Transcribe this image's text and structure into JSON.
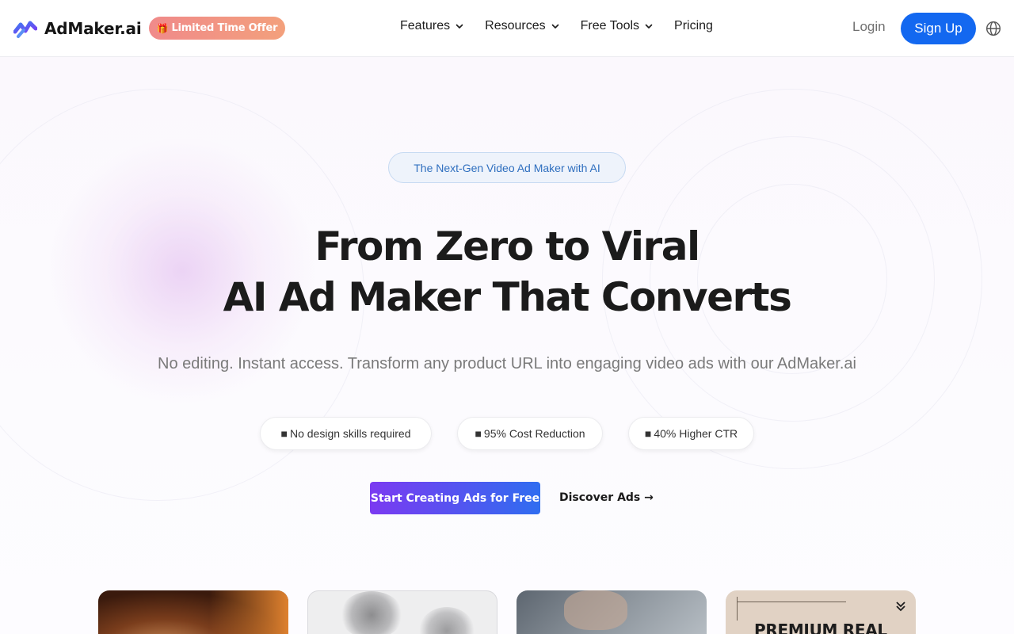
{
  "brand": {
    "name": "AdMaker.ai",
    "offer_label": "Limited Time Offer",
    "offer_icon": "gift-icon"
  },
  "nav": {
    "items": [
      {
        "label": "Features",
        "has_dropdown": true
      },
      {
        "label": "Resources",
        "has_dropdown": true
      },
      {
        "label": "Free Tools",
        "has_dropdown": true
      },
      {
        "label": "Pricing",
        "has_dropdown": false
      }
    ],
    "login_label": "Login",
    "signup_label": "Sign Up",
    "language_icon": "globe-icon"
  },
  "hero": {
    "tag": "The Next-Gen Video Ad Maker with AI",
    "headline_line1": "From Zero to Viral",
    "headline_line2": "AI Ad Maker That Converts",
    "subtitle": "No editing. Instant access. Transform any product URL into engaging video ads with our AdMaker.ai",
    "features": [
      {
        "label": "No design skills required"
      },
      {
        "label": "95% Cost Reduction"
      },
      {
        "label": "40% Higher CTR"
      }
    ],
    "cta_primary": "Start Creating Ads for Free",
    "cta_secondary": "Discover Ads →"
  },
  "showcase": {
    "cards": [
      {
        "caption": ""
      },
      {
        "caption": ""
      },
      {
        "caption": ""
      },
      {
        "caption": "PREMIUM REAL"
      }
    ]
  },
  "colors": {
    "primary_blue": "#1368f0",
    "offer_gradient_start": "#f08a8a",
    "offer_gradient_end": "#f3a07c",
    "cta_gradient_start": "#7b3af1",
    "cta_gradient_end": "#2f6df0"
  }
}
